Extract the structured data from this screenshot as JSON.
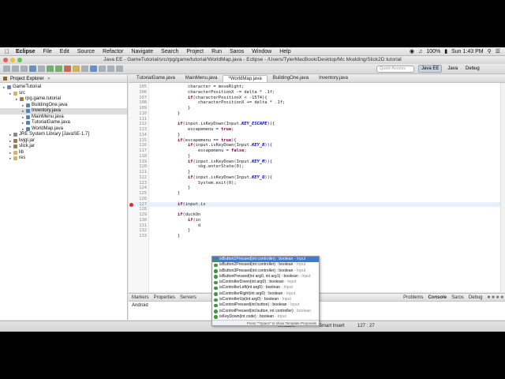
{
  "menubar": {
    "app": "Eclipse",
    "items": [
      "File",
      "Edit",
      "Source",
      "Refactor",
      "Navigate",
      "Search",
      "Project",
      "Run",
      "Saros",
      "Window",
      "Help"
    ],
    "battery": "100%",
    "clock": "Sun 1:43 PM"
  },
  "window": {
    "title": "Java EE - GameTutorial/src/rpg/game/tutorial/WorldMap.java - Eclipse - /Users/TylerMacBook/Desktop/Mc Modding/Slick2D tutorial"
  },
  "toolbar": {
    "quick_access": "Quick Access",
    "perspectives": [
      "Java EE",
      "Java",
      "Debug"
    ]
  },
  "package_explorer": {
    "title": "Project Explorer",
    "tree": [
      {
        "label": "GameTutorial",
        "depth": 0,
        "icon": "project-icon"
      },
      {
        "label": "src",
        "depth": 1,
        "icon": "folder-icon"
      },
      {
        "label": "rpg.game.tutorial",
        "depth": 2,
        "icon": "package-icon"
      },
      {
        "label": "BuildingOne.java",
        "depth": 3,
        "icon": "java-file-icon"
      },
      {
        "label": "Inventory.java",
        "depth": 3,
        "icon": "java-file-icon",
        "selected": true
      },
      {
        "label": "MainMenu.java",
        "depth": 3,
        "icon": "java-file-icon"
      },
      {
        "label": "TutorialGame.java",
        "depth": 3,
        "icon": "java-file-icon"
      },
      {
        "label": "WorldMap.java",
        "depth": 3,
        "icon": "java-file-icon"
      },
      {
        "label": "JRE System Library [JavaSE-1.7]",
        "depth": 1,
        "icon": "library-icon"
      },
      {
        "label": "lwjgl.jar",
        "depth": 1,
        "icon": "jar-icon"
      },
      {
        "label": "slick.jar",
        "depth": 1,
        "icon": "jar-icon"
      },
      {
        "label": "lib",
        "depth": 1,
        "icon": "folder-icon"
      },
      {
        "label": "res",
        "depth": 1,
        "icon": "folder-icon"
      }
    ]
  },
  "editor": {
    "tabs": [
      {
        "label": "TutorialGame.java"
      },
      {
        "label": "MainMenu.java"
      },
      {
        "label": "*WorldMap.java",
        "active": true
      },
      {
        "label": "BuildingOne.java"
      },
      {
        "label": "Inventory.java"
      }
    ],
    "lines": [
      {
        "n": "105",
        "t": "            character = moveRight;"
      },
      {
        "n": "106",
        "t": "            characterPositionX -= delta * .1f;"
      },
      {
        "n": "107",
        "t": "            if(characterPositionX < -1574){"
      },
      {
        "n": "108",
        "t": "                characterPositionX += delta * .1f;"
      },
      {
        "n": "109",
        "t": "            }"
      },
      {
        "n": "110",
        "t": "        }"
      },
      {
        "n": "111",
        "t": ""
      },
      {
        "n": "112",
        "t": "        if(input.isKeyDown(Input.KEY_ESCAPE)){"
      },
      {
        "n": "113",
        "t": "            escapemenu = true;"
      },
      {
        "n": "114",
        "t": "        }"
      },
      {
        "n": "115",
        "t": "        if(escapemenu == true){"
      },
      {
        "n": "116",
        "t": "            if(input.isKeyDown(Input.KEY_R)){"
      },
      {
        "n": "117",
        "t": "                escapemenu = false;"
      },
      {
        "n": "118",
        "t": "            }"
      },
      {
        "n": "119",
        "t": "            if(input.isKeyDown(Input.KEY_M)){"
      },
      {
        "n": "120",
        "t": "                sbg.enterState(0);"
      },
      {
        "n": "121",
        "t": "            }"
      },
      {
        "n": "122",
        "t": "            if(input.isKeyDown(Input.KEY_Q)){"
      },
      {
        "n": "123",
        "t": "                System.exit(0);"
      },
      {
        "n": "124",
        "t": "            }"
      },
      {
        "n": "125",
        "t": "        }"
      },
      {
        "n": "126",
        "t": ""
      },
      {
        "n": "127",
        "t": "        if(input.is",
        "current": true,
        "error": true
      },
      {
        "n": "128",
        "t": ""
      },
      {
        "n": "129",
        "t": "        if(duckOn"
      },
      {
        "n": "130",
        "t": "            if(in"
      },
      {
        "n": "131",
        "t": "                d"
      },
      {
        "n": "132",
        "t": "            }"
      },
      {
        "n": "133",
        "t": "        }"
      }
    ]
  },
  "assist": {
    "items": [
      {
        "sig": "isButton1Pressed(int controller) : boolean",
        "cls": " - Input",
        "selected": true
      },
      {
        "sig": "isButton2Pressed(int controller) : boolean",
        "cls": " - Input"
      },
      {
        "sig": "isButton3Pressed(int controller) : boolean",
        "cls": " - Input"
      },
      {
        "sig": "isButtonPressed(int arg0, int arg1) : boolean",
        "cls": " - Input"
      },
      {
        "sig": "isControllerDown(int arg0) : boolean",
        "cls": " - Input"
      },
      {
        "sig": "isControllerLeft(int arg0) : boolean",
        "cls": " - Input"
      },
      {
        "sig": "isControllerRight(int arg0) : boolean",
        "cls": " - Input"
      },
      {
        "sig": "isControllerUp(int arg0) : boolean",
        "cls": " - Input"
      },
      {
        "sig": "isControlPressed(int button) : boolean",
        "cls": " - Input"
      },
      {
        "sig": "isControlPressed(int button, int controller)",
        "cls": " : boolean"
      },
      {
        "sig": "isKeyDown(int code) : boolean",
        "cls": " - Input"
      }
    ],
    "footer": "Press \"^Space\" to show Template Proposals"
  },
  "bottom_panel": {
    "left_tabs": [
      "Markers",
      "Properties",
      "Servers"
    ],
    "right_tabs": [
      "Problems",
      "Console",
      "Saros",
      "Debug"
    ],
    "active": "Console",
    "content": "Android"
  },
  "statusbar": {
    "mode": "Writable",
    "insert": "Smart Insert",
    "position": "127 : 27"
  }
}
